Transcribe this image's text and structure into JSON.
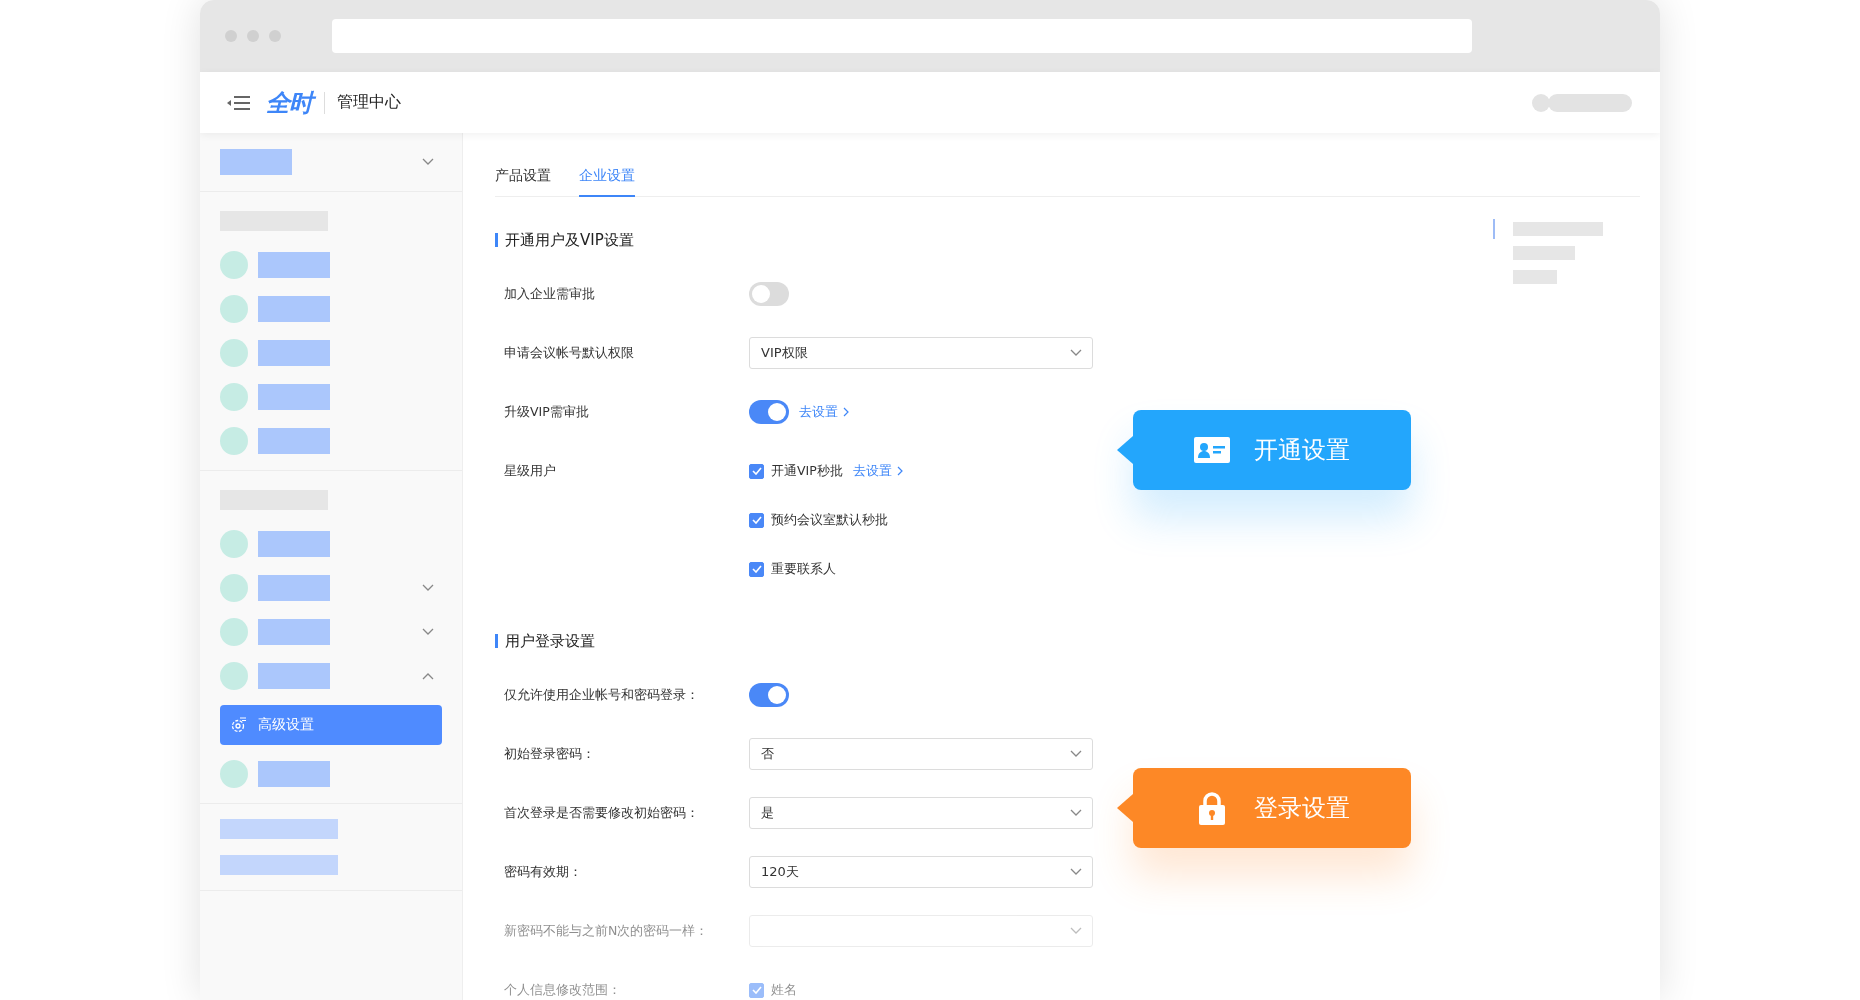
{
  "header": {
    "logo": "全时",
    "title": "管理中心"
  },
  "sidebar": {
    "groups": [
      {
        "items": [
          {
            "kind": "header",
            "expanded": false
          }
        ]
      },
      {
        "items": [
          {
            "kind": "caption"
          },
          {
            "kind": "entry",
            "selected": false
          },
          {
            "kind": "entry",
            "selected": false
          },
          {
            "kind": "entry",
            "selected": false
          },
          {
            "kind": "entry",
            "selected": false
          },
          {
            "kind": "entry",
            "selected": false
          }
        ]
      },
      {
        "items": [
          {
            "kind": "caption"
          },
          {
            "kind": "entry",
            "selected": false
          },
          {
            "kind": "entry",
            "selected": false,
            "expanded": false
          },
          {
            "kind": "entry",
            "selected": false,
            "expanded": false
          },
          {
            "kind": "entry",
            "selected": false,
            "expanded": true
          },
          {
            "kind": "link",
            "label": "高级设置",
            "selected": true
          },
          {
            "kind": "entry",
            "selected": false
          }
        ]
      },
      {
        "items": [
          {
            "kind": "footer"
          },
          {
            "kind": "footer"
          }
        ]
      }
    ]
  },
  "tabs": [
    {
      "label": "产品设置",
      "selected": false
    },
    {
      "label": "企业设置",
      "selected": true
    }
  ],
  "sections": [
    {
      "title": "开通用户及VIP设置",
      "rows": [
        {
          "label": "加入企业需审批",
          "kind": "switch",
          "on": false
        },
        {
          "label": "申请会议帐号默认权限",
          "kind": "select",
          "value": "VIP权限"
        },
        {
          "label": "升级VIP需审批",
          "kind": "switch",
          "on": true,
          "link": "去设置"
        },
        {
          "label": "星级用户",
          "kind": "checks",
          "options": [
            {
              "label": "开通VIP秒批",
              "checked": true,
              "link": "去设置"
            },
            {
              "label": "预约会议室默认秒批",
              "checked": true
            },
            {
              "label": "重要联系人",
              "checked": true
            }
          ]
        }
      ]
    },
    {
      "title": "用户登录设置",
      "rows": [
        {
          "label": "仅允许使用企业帐号和密码登录：",
          "kind": "switch",
          "on": true
        },
        {
          "label": "初始登录密码：",
          "kind": "select",
          "value": "否"
        },
        {
          "label": "首次登录是否需要修改初始密码：",
          "kind": "select",
          "value": "是"
        },
        {
          "label": "密码有效期：",
          "kind": "select",
          "value": "120天"
        },
        {
          "label": "新密码不能与之前N次的密码一样：",
          "kind": "select"
        },
        {
          "label": "个人信息修改范围：",
          "kind": "checks",
          "options": [
            {
              "label": "姓名",
              "checked": true
            }
          ]
        }
      ]
    }
  ],
  "callouts": [
    {
      "label": "开通设置",
      "kind": "card",
      "color": "#23a6fc"
    },
    {
      "label": "登录设置",
      "kind": "lock",
      "color": "#fd8826"
    }
  ]
}
